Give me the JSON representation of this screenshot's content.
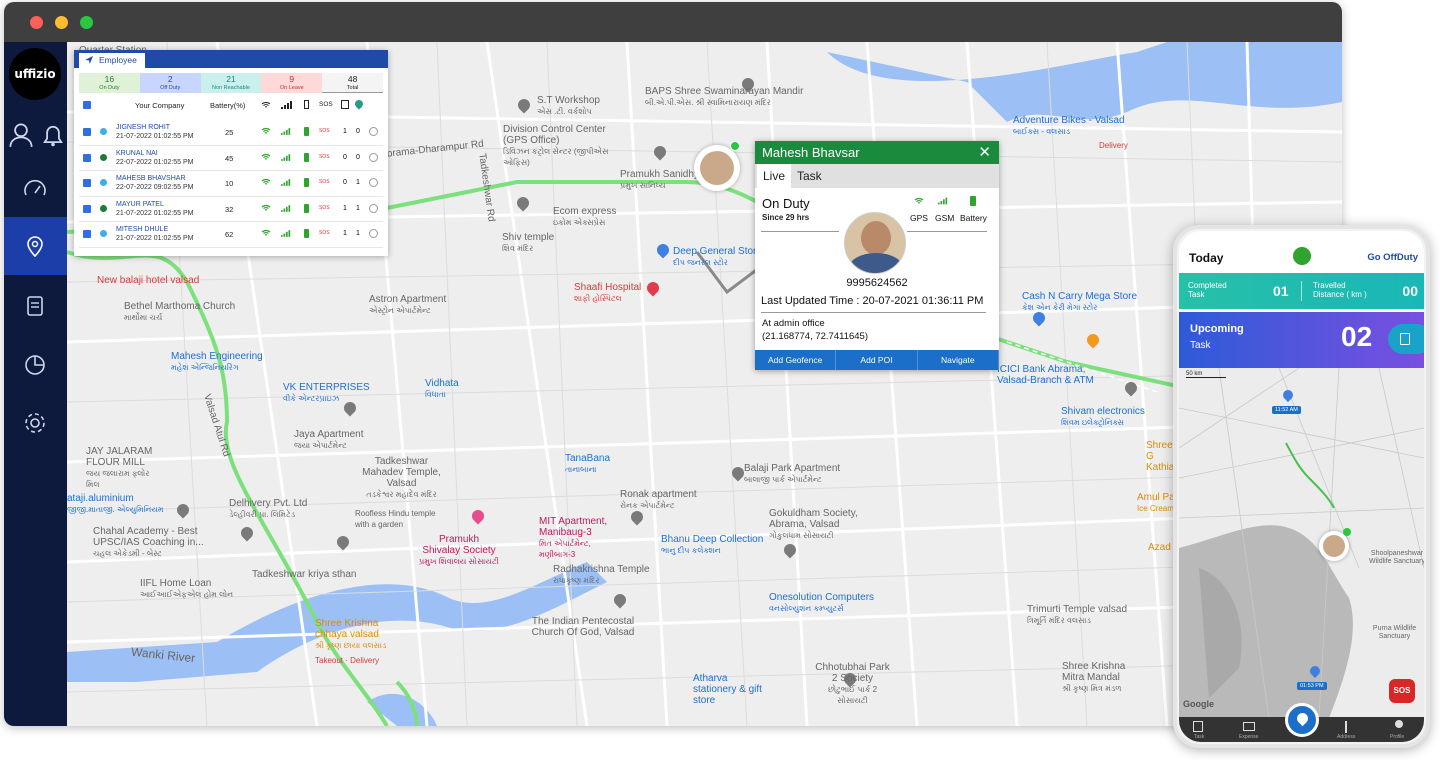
{
  "app": {
    "logo_text": "uffizio"
  },
  "sidebar": {
    "icons": [
      "user-icon",
      "bell-icon",
      "speedometer-icon",
      "location-icon",
      "report-icon",
      "chart-icon",
      "settings-icon"
    ]
  },
  "employee_panel": {
    "tab_label": "Employee",
    "counts": [
      {
        "value": "16",
        "label": "On Duty"
      },
      {
        "value": "2",
        "label": "Off Duty"
      },
      {
        "value": "21",
        "label": "Non Reachable"
      },
      {
        "value": "9",
        "label": "On Leave"
      },
      {
        "value": "48",
        "label": "Total"
      }
    ],
    "columns": {
      "company": "Your Company",
      "battery": "Battery(%)",
      "sos": "SOS"
    },
    "rows": [
      {
        "name": "JIGNESH ROHIT",
        "time": "21-07-2022 01:02:55 PM",
        "battery": "25",
        "sos": "SOS",
        "n1": "1",
        "n2": "0",
        "status": "#3bb0e8"
      },
      {
        "name": "KRUNAL NAI",
        "time": "22-07-2022 01:02:55 PM",
        "battery": "45",
        "sos": "SOS",
        "n1": "0",
        "n2": "0",
        "status": "#1f7a3a"
      },
      {
        "name": "MAHESB BHAVSHAR",
        "time": "22-07-2022 09:02:55 PM",
        "battery": "10",
        "sos": "SOS",
        "n1": "0",
        "n2": "1",
        "status": "#3bb0e8"
      },
      {
        "name": "MAYUR PATEL",
        "time": "21-07-2022 01:02:55 PM",
        "battery": "32",
        "sos": "SOS",
        "n1": "1",
        "n2": "1",
        "status": "#1f7a3a"
      },
      {
        "name": "MITESH DHULE",
        "time": "21-07-2022 01:02:55 PM",
        "battery": "62",
        "sos": "SOS",
        "n1": "1",
        "n2": "1",
        "status": "#3bb0e8"
      }
    ]
  },
  "popup": {
    "title": "Mahesh Bhavsar",
    "tabs": [
      "Live",
      "Task"
    ],
    "status": "On Duty",
    "since": "Since 29 hrs",
    "indicators": [
      "GPS",
      "GSM",
      "Battery"
    ],
    "phone": "9995624562",
    "last_updated": "Last Updated Time : 20-07-2021 01:36:11 PM",
    "location": "At admin office",
    "coords": "(21.168774, 72.7411645)",
    "actions": [
      "Add Geofence",
      "Add POI",
      "Navigate"
    ]
  },
  "map_labels": [
    {
      "t": "Quarter Station",
      "c": "gray"
    },
    {
      "t": "S.T Workshop",
      "s": "એસ .ટી. વર્કશોપ",
      "c": "gray"
    },
    {
      "t": "BAPS Shree Swaminarayan Mandir",
      "s": "બી.એ.પી.એસ. શ્રી સ્વામિનારાયણ મંદિર",
      "c": "gray"
    },
    {
      "t": "Division Control Center (GPS Office)",
      "s": "ડિવિઝન કંટ્રોલ સેન્ટર (જીપીએસ ઓફિસ)",
      "c": "gray"
    },
    {
      "t": "Pramukh Sanidhya",
      "s": "પ્રમુખ સાનિધ્ય",
      "c": "gray"
    },
    {
      "t": "Abrama-Dharampur Rd",
      "c": "gray"
    },
    {
      "t": "Ecom express",
      "s": "ઇકોમ એક્સપ્રેસ",
      "c": "gray"
    },
    {
      "t": "Shiv temple",
      "s": "શિવ મંદિર",
      "c": "gray"
    },
    {
      "t": "Deep General Store",
      "s": "દીપ જનરલ સ્ટોર",
      "c": "blue"
    },
    {
      "t": "Shaafi Hospital",
      "s": "શાફી હોસ્પિટલ",
      "c": "red"
    },
    {
      "t": "Astron Apartment",
      "s": "એસ્ટ્રોન એપાર્ટમેન્ટ",
      "c": "gray"
    },
    {
      "t": "Bethel Marthoma Church",
      "s": "માર્થોમા ચર્ચ",
      "c": "gray"
    },
    {
      "t": "New balaji hotel valsad",
      "c": "red"
    },
    {
      "t": "Mahesh Engineering",
      "s": "મહેશ એન્જિનિયરિંગ",
      "c": "blue"
    },
    {
      "t": "VK ENTERPRISES",
      "s": "વીકે એન્ટરપ્રાઇઝ",
      "c": "blue"
    },
    {
      "t": "Vidhata",
      "s": "વિધાતા",
      "c": "blue"
    },
    {
      "t": "Jaya Apartment",
      "s": "જયા એપાર્ટમેન્ટ",
      "c": "gray"
    },
    {
      "t": "JAY JALARAM FLOUR MILL",
      "s": "જય જલારામ ફ્લોર મિલ",
      "c": "gray"
    },
    {
      "t": "Tadkeshwar Mahadev Temple, Valsad",
      "s": "તડકેશ્વર મહાદેવ મંદિર",
      "c": "gray"
    },
    {
      "t": "Delhivery Pvt. Ltd",
      "s": "ડેલ્હીવરી પ્રા. લિમિટેડ",
      "c": "gray"
    },
    {
      "t": "TanaBana",
      "s": "તાનાબાના",
      "c": "blue"
    },
    {
      "t": "Balaji Park Apartment",
      "s": "બાલાજી પાર્ક એપાર્ટમેન્ટ",
      "c": "gray"
    },
    {
      "t": "Ronak apartment",
      "s": "રોનક એપાર્ટમેન્ટ",
      "c": "gray"
    },
    {
      "t": "Gokuldham Society, Abrama, Valsad",
      "s": "ગોકુલધામ સોસાયટી",
      "c": "gray"
    },
    {
      "t": "Roofless Hindu temple with a garden",
      "c": "gray"
    },
    {
      "t": "Pramukh Shivalay Society",
      "s": "પ્રમુખ શિવાલય સોસાયટી",
      "c": "pink"
    },
    {
      "t": "MIT Apartment, Manibaug-3",
      "s": "મિત એપાર્ટમેન્ટ, મણીબાગ-3",
      "c": "pink"
    },
    {
      "t": "Bhanu Deep Collection",
      "s": "ભાનુ દીપ કલેક્શન",
      "c": "blue"
    },
    {
      "t": "ataji.aluminium",
      "s": "જીજી.માતાજી. એલ્યુમિનિયમ",
      "c": "blue"
    },
    {
      "t": "Chahal Academy - Best UPSC/IAS Coaching in...",
      "s": "ચહલ એકેડમી - બેસ્ટ",
      "c": "gray"
    },
    {
      "t": "IIFL Home Loan",
      "s": "આઈઆઈએફએલ હોમ લોન",
      "c": "gray"
    },
    {
      "t": "Tadkeshwar kriya sthan",
      "c": "gray"
    },
    {
      "t": "Radhakrishna Temple",
      "s": "રાધાકૃષ્ણ મંદિર",
      "c": "gray"
    },
    {
      "t": "Shree Krishna chhaya valsad",
      "s": "શ્રી કૃષ્ણ છાયા વલસાડ",
      "c": "orange"
    },
    {
      "t": "Takeout · Delivery",
      "c": "red"
    },
    {
      "t": "Onesolution Computers",
      "s": "વનસોલ્યુશન કમ્પ્યુટર્સ",
      "c": "blue"
    },
    {
      "t": "The Indian Pentecostal Church Of God, Valsad",
      "c": "gray"
    },
    {
      "t": "Atharva stationery & gift store",
      "c": "blue"
    },
    {
      "t": "Chhotubhai Park 2 Society",
      "s": "છોટુભાઈ પાર્ક 2 સોસાયટી",
      "c": "gray"
    },
    {
      "t": "Trimurti Temple valsad",
      "s": "ત્રિમૂર્તિ મંદિર વલસાડ",
      "c": "gray"
    },
    {
      "t": "Shree Krishna Mitra Mandal",
      "s": "શ્રી કૃષ્ણ મિત્ર મંડળ",
      "c": "gray"
    },
    {
      "t": "Cash N Carry Mega Store",
      "s": "કેશ એન કેરી મેગા સ્ટોર",
      "c": "blue"
    },
    {
      "t": "Adventure Bikes - Valsad",
      "s": "બાઈક્સ - વલસાડ",
      "c": "blue"
    },
    {
      "t": "Delivery",
      "c": "red"
    },
    {
      "t": "ICICI Bank Abrama, Valsad-Branch & ATM",
      "c": "blue"
    },
    {
      "t": "Shivam electronics",
      "s": "શિવમ ઇલેક્ટ્રોનિક્સ",
      "c": "blue"
    },
    {
      "t": "Shree G Kathiawa",
      "c": "orange"
    },
    {
      "t": "Amul Pa",
      "s": "Ice Cream",
      "c": "orange"
    },
    {
      "t": "Azad I",
      "c": "orange"
    },
    {
      "t": "Wanki River",
      "c": "gray"
    },
    {
      "t": "Tadkeshwar Rd",
      "c": "gray"
    },
    {
      "t": "Valsad Atul Rd",
      "c": "gray"
    }
  ],
  "phone_app": {
    "today": "Today",
    "go_offduty": "Go OffDuty",
    "completed_label": "Completed",
    "completed_sub": "Task",
    "completed_value": "01",
    "travelled_label": "Travelled",
    "travelled_sub": "Distance ( km )",
    "travelled_value": "00",
    "upcoming_label": "Upcoming",
    "upcoming_sub": "Task",
    "upcoming_value": "02",
    "scale": "50 km",
    "time1": "11:52 AM",
    "time2": "01:53 PM",
    "google": "Google",
    "sos": "SOS",
    "map_l1": "Shoolpaneshwar Wildlife Sanctuary",
    "map_l2": "Purna Wildlife Sanctuary",
    "nav": [
      "Task",
      "Expense",
      "",
      "Address",
      "Profile"
    ]
  }
}
